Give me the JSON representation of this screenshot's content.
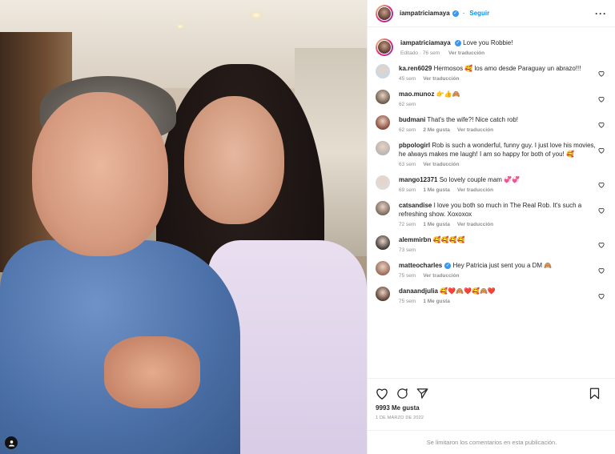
{
  "post": {
    "username": "iampatriciamaya",
    "follow_label": "Seguir",
    "caption": "Love you Robbie!",
    "caption_meta_edited": "Editado · 76 sem",
    "caption_meta_translate": "Ver traducción",
    "likes": "9993 Me gusta",
    "date": "1 DE MARZO DE 2022",
    "comments_limited": "Se limitaron los comentarios en esta publicación."
  },
  "comments": [
    {
      "user": "ka.ren6029",
      "text": "Hermosos 🥰 los amo desde Paraguay un abrazo!!!",
      "time": "45 sem",
      "likes": "",
      "translate": "Ver traducción",
      "avatar_color": "#c9d8e6"
    },
    {
      "user": "mao.munoz",
      "text": "👉👍🙈",
      "time": "62 sem",
      "likes": "",
      "translate": "",
      "avatar_color": "#6a5a4a"
    },
    {
      "user": "budmani",
      "text": "That's the wife?! Nice catch rob!",
      "time": "62 sem",
      "likes": "2 Me gusta",
      "translate": "Ver traducción",
      "avatar_color": "#8a4a3a"
    },
    {
      "user": "pbpologirl",
      "text": "Rob is such a wonderful, funny guy. I just love his movies, he always makes me laugh! I am so happy for both of you! 🥰",
      "time": "63 sem",
      "likes": "",
      "translate": "Ver traducción",
      "avatar_color": "#b9b5b0"
    },
    {
      "user": "mango12371",
      "text": "So lovely couple mam 💞💞",
      "time": "69 sem",
      "likes": "1 Me gusta",
      "translate": "Ver traducción",
      "avatar_color": "#dcdcdc"
    },
    {
      "user": "catsandise",
      "text": "I love you both so much in The Real Rob. It's such a refreshing show. Xoxoxox",
      "time": "72 sem",
      "likes": "1 Me gusta",
      "translate": "Ver traducción",
      "avatar_color": "#7a6a5e"
    },
    {
      "user": "alemmirbn",
      "text": "🥰🥰🥰🥰",
      "time": "73 sem",
      "likes": "",
      "translate": "",
      "avatar_color": "#3e3a38"
    },
    {
      "user": "matteocharles",
      "text": "Hey Patricia just sent you a DM 🙈",
      "time": "75 sem",
      "likes": "",
      "translate": "Ver traducción",
      "avatar_color": "#9a6a58",
      "verified": true
    },
    {
      "user": "danaandjulia",
      "text": "🥰❤️🙈❤️🥰🙈❤️",
      "time": "75 sem",
      "likes": "1 Me gusta",
      "translate": "",
      "avatar_color": "#5a3e30"
    }
  ]
}
